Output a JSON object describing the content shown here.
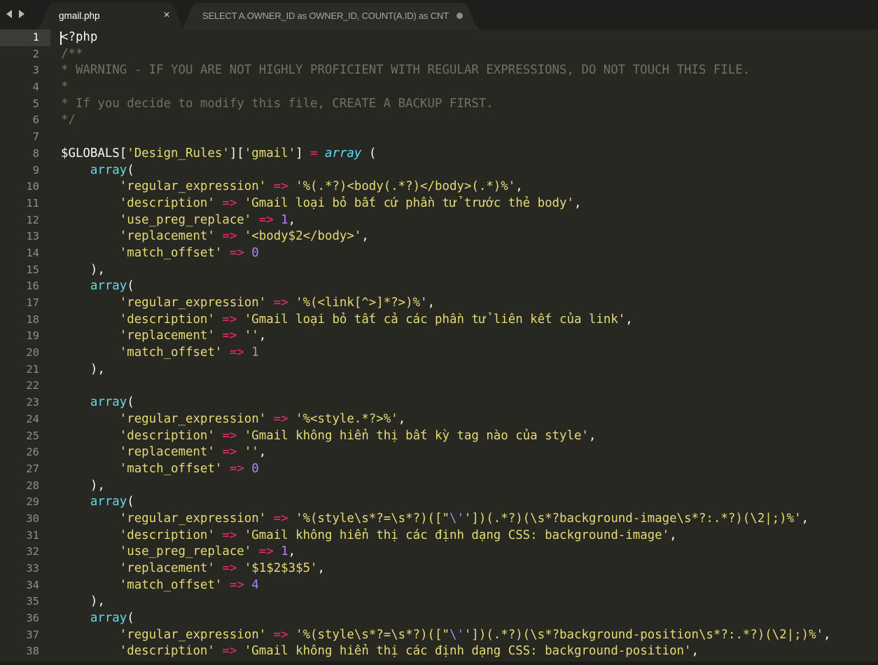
{
  "tabs": [
    {
      "label": "gmail.php",
      "active": true,
      "close_glyph": "×"
    },
    {
      "label": "SELECT A.OWNER_ID as OWNER_ID, COUNT(A.ID) as CNT",
      "active": false,
      "dirty": true
    }
  ],
  "colors": {
    "background": "#272822",
    "tabbar": "#1e1f1c",
    "comment": "#75715e",
    "string": "#e6db74",
    "keyword": "#f92672",
    "function": "#66d9ef",
    "number": "#ae81ff",
    "text": "#f8f8f2"
  },
  "current_line": 1,
  "lines": [
    {
      "n": "1",
      "tokens": [
        {
          "t": "<?php",
          "c": "plain"
        }
      ]
    },
    {
      "n": "2",
      "tokens": [
        {
          "t": "/**",
          "c": "comment"
        }
      ]
    },
    {
      "n": "3",
      "tokens": [
        {
          "t": "* WARNING - IF YOU ARE NOT HIGHLY PROFICIENT WITH REGULAR EXPRESSIONS, DO NOT TOUCH THIS FILE.",
          "c": "comment"
        }
      ]
    },
    {
      "n": "4",
      "tokens": [
        {
          "t": "*",
          "c": "comment"
        }
      ]
    },
    {
      "n": "5",
      "tokens": [
        {
          "t": "* If you decide to modify this file, CREATE A BACKUP FIRST.",
          "c": "comment"
        }
      ]
    },
    {
      "n": "6",
      "tokens": [
        {
          "t": "*/",
          "c": "comment"
        }
      ]
    },
    {
      "n": "7",
      "tokens": []
    },
    {
      "n": "8",
      "tokens": [
        {
          "t": "$GLOBALS[",
          "c": "plain"
        },
        {
          "t": "'Design_Rules'",
          "c": "string"
        },
        {
          "t": "][",
          "c": "plain"
        },
        {
          "t": "'gmail'",
          "c": "string"
        },
        {
          "t": "] ",
          "c": "plain"
        },
        {
          "t": "=",
          "c": "keyword"
        },
        {
          "t": " ",
          "c": "plain"
        },
        {
          "t": "array",
          "c": "storage"
        },
        {
          "t": " (",
          "c": "plain"
        }
      ]
    },
    {
      "n": "9",
      "tokens": [
        {
          "t": "    ",
          "c": "plain"
        },
        {
          "t": "array",
          "c": "func"
        },
        {
          "t": "(",
          "c": "plain"
        }
      ]
    },
    {
      "n": "10",
      "tokens": [
        {
          "t": "        ",
          "c": "plain"
        },
        {
          "t": "'regular_expression'",
          "c": "string"
        },
        {
          "t": " ",
          "c": "plain"
        },
        {
          "t": "=>",
          "c": "keyword"
        },
        {
          "t": " ",
          "c": "plain"
        },
        {
          "t": "'%(.*?)<body(.*?)</body>(.*)%'",
          "c": "string"
        },
        {
          "t": ",",
          "c": "plain"
        }
      ]
    },
    {
      "n": "11",
      "tokens": [
        {
          "t": "        ",
          "c": "plain"
        },
        {
          "t": "'description'",
          "c": "string"
        },
        {
          "t": " ",
          "c": "plain"
        },
        {
          "t": "=>",
          "c": "keyword"
        },
        {
          "t": " ",
          "c": "plain"
        },
        {
          "t": "'Gmail loại bỏ bất cứ phần tử trước thẻ body'",
          "c": "string"
        },
        {
          "t": ",",
          "c": "plain"
        }
      ]
    },
    {
      "n": "12",
      "tokens": [
        {
          "t": "        ",
          "c": "plain"
        },
        {
          "t": "'use_preg_replace'",
          "c": "string"
        },
        {
          "t": " ",
          "c": "plain"
        },
        {
          "t": "=>",
          "c": "keyword"
        },
        {
          "t": " ",
          "c": "plain"
        },
        {
          "t": "1",
          "c": "number"
        },
        {
          "t": ",",
          "c": "plain"
        }
      ]
    },
    {
      "n": "13",
      "tokens": [
        {
          "t": "        ",
          "c": "plain"
        },
        {
          "t": "'replacement'",
          "c": "string"
        },
        {
          "t": " ",
          "c": "plain"
        },
        {
          "t": "=>",
          "c": "keyword"
        },
        {
          "t": " ",
          "c": "plain"
        },
        {
          "t": "'<body$2</body>'",
          "c": "string"
        },
        {
          "t": ",",
          "c": "plain"
        }
      ]
    },
    {
      "n": "14",
      "tokens": [
        {
          "t": "        ",
          "c": "plain"
        },
        {
          "t": "'match_offset'",
          "c": "string"
        },
        {
          "t": " ",
          "c": "plain"
        },
        {
          "t": "=>",
          "c": "keyword"
        },
        {
          "t": " ",
          "c": "plain"
        },
        {
          "t": "0",
          "c": "number"
        }
      ]
    },
    {
      "n": "15",
      "tokens": [
        {
          "t": "    ),",
          "c": "plain"
        }
      ]
    },
    {
      "n": "16",
      "tokens": [
        {
          "t": "    ",
          "c": "plain"
        },
        {
          "t": "array",
          "c": "func"
        },
        {
          "t": "(",
          "c": "plain"
        }
      ]
    },
    {
      "n": "17",
      "tokens": [
        {
          "t": "        ",
          "c": "plain"
        },
        {
          "t": "'regular_expression'",
          "c": "string"
        },
        {
          "t": " ",
          "c": "plain"
        },
        {
          "t": "=>",
          "c": "keyword"
        },
        {
          "t": " ",
          "c": "plain"
        },
        {
          "t": "'%(<link[^>]*?>)%'",
          "c": "string"
        },
        {
          "t": ",",
          "c": "plain"
        }
      ]
    },
    {
      "n": "18",
      "tokens": [
        {
          "t": "        ",
          "c": "plain"
        },
        {
          "t": "'description'",
          "c": "string"
        },
        {
          "t": " ",
          "c": "plain"
        },
        {
          "t": "=>",
          "c": "keyword"
        },
        {
          "t": " ",
          "c": "plain"
        },
        {
          "t": "'Gmail loại bỏ tất cả các phần tử liên kết của link'",
          "c": "string"
        },
        {
          "t": ",",
          "c": "plain"
        }
      ]
    },
    {
      "n": "19",
      "tokens": [
        {
          "t": "        ",
          "c": "plain"
        },
        {
          "t": "'replacement'",
          "c": "string"
        },
        {
          "t": " ",
          "c": "plain"
        },
        {
          "t": "=>",
          "c": "keyword"
        },
        {
          "t": " ",
          "c": "plain"
        },
        {
          "t": "''",
          "c": "string"
        },
        {
          "t": ",",
          "c": "plain"
        }
      ]
    },
    {
      "n": "20",
      "tokens": [
        {
          "t": "        ",
          "c": "plain"
        },
        {
          "t": "'match_offset'",
          "c": "string"
        },
        {
          "t": " ",
          "c": "plain"
        },
        {
          "t": "=>",
          "c": "keyword"
        },
        {
          "t": " ",
          "c": "plain"
        },
        {
          "t": "1",
          "c": "number"
        }
      ]
    },
    {
      "n": "21",
      "tokens": [
        {
          "t": "    ),",
          "c": "plain"
        }
      ]
    },
    {
      "n": "22",
      "tokens": []
    },
    {
      "n": "23",
      "tokens": [
        {
          "t": "    ",
          "c": "plain"
        },
        {
          "t": "array",
          "c": "func"
        },
        {
          "t": "(",
          "c": "plain"
        }
      ]
    },
    {
      "n": "24",
      "tokens": [
        {
          "t": "        ",
          "c": "plain"
        },
        {
          "t": "'regular_expression'",
          "c": "string"
        },
        {
          "t": " ",
          "c": "plain"
        },
        {
          "t": "=>",
          "c": "keyword"
        },
        {
          "t": " ",
          "c": "plain"
        },
        {
          "t": "'%<style.*?>%'",
          "c": "string"
        },
        {
          "t": ",",
          "c": "plain"
        }
      ]
    },
    {
      "n": "25",
      "tokens": [
        {
          "t": "        ",
          "c": "plain"
        },
        {
          "t": "'description'",
          "c": "string"
        },
        {
          "t": " ",
          "c": "plain"
        },
        {
          "t": "=>",
          "c": "keyword"
        },
        {
          "t": " ",
          "c": "plain"
        },
        {
          "t": "'Gmail không hiển thị bất kỳ tag nào của style'",
          "c": "string"
        },
        {
          "t": ",",
          "c": "plain"
        }
      ]
    },
    {
      "n": "26",
      "tokens": [
        {
          "t": "        ",
          "c": "plain"
        },
        {
          "t": "'replacement'",
          "c": "string"
        },
        {
          "t": " ",
          "c": "plain"
        },
        {
          "t": "=>",
          "c": "keyword"
        },
        {
          "t": " ",
          "c": "plain"
        },
        {
          "t": "''",
          "c": "string"
        },
        {
          "t": ",",
          "c": "plain"
        }
      ]
    },
    {
      "n": "27",
      "tokens": [
        {
          "t": "        ",
          "c": "plain"
        },
        {
          "t": "'match_offset'",
          "c": "string"
        },
        {
          "t": " ",
          "c": "plain"
        },
        {
          "t": "=>",
          "c": "keyword"
        },
        {
          "t": " ",
          "c": "plain"
        },
        {
          "t": "0",
          "c": "number"
        }
      ]
    },
    {
      "n": "28",
      "tokens": [
        {
          "t": "    ),",
          "c": "plain"
        }
      ]
    },
    {
      "n": "29",
      "tokens": [
        {
          "t": "    ",
          "c": "plain"
        },
        {
          "t": "array",
          "c": "func"
        },
        {
          "t": "(",
          "c": "plain"
        }
      ]
    },
    {
      "n": "30",
      "tokens": [
        {
          "t": "        ",
          "c": "plain"
        },
        {
          "t": "'regular_expression'",
          "c": "string"
        },
        {
          "t": " ",
          "c": "plain"
        },
        {
          "t": "=>",
          "c": "keyword"
        },
        {
          "t": " ",
          "c": "plain"
        },
        {
          "t": "'%(style\\s*?=\\s*?)([\"",
          "c": "string"
        },
        {
          "t": "\\'",
          "c": "escape"
        },
        {
          "t": "'])(.*?)(\\s*?background-image\\s*?:.*?)(\\2|;)%'",
          "c": "string"
        },
        {
          "t": ",",
          "c": "plain"
        }
      ]
    },
    {
      "n": "31",
      "tokens": [
        {
          "t": "        ",
          "c": "plain"
        },
        {
          "t": "'description'",
          "c": "string"
        },
        {
          "t": " ",
          "c": "plain"
        },
        {
          "t": "=>",
          "c": "keyword"
        },
        {
          "t": " ",
          "c": "plain"
        },
        {
          "t": "'Gmail không hiển thị các định dạng CSS: background-image'",
          "c": "string"
        },
        {
          "t": ",",
          "c": "plain"
        }
      ]
    },
    {
      "n": "32",
      "tokens": [
        {
          "t": "        ",
          "c": "plain"
        },
        {
          "t": "'use_preg_replace'",
          "c": "string"
        },
        {
          "t": " ",
          "c": "plain"
        },
        {
          "t": "=>",
          "c": "keyword"
        },
        {
          "t": " ",
          "c": "plain"
        },
        {
          "t": "1",
          "c": "number"
        },
        {
          "t": ",",
          "c": "plain"
        }
      ]
    },
    {
      "n": "33",
      "tokens": [
        {
          "t": "        ",
          "c": "plain"
        },
        {
          "t": "'replacement'",
          "c": "string"
        },
        {
          "t": " ",
          "c": "plain"
        },
        {
          "t": "=>",
          "c": "keyword"
        },
        {
          "t": " ",
          "c": "plain"
        },
        {
          "t": "'$1$2$3$5'",
          "c": "string"
        },
        {
          "t": ",",
          "c": "plain"
        }
      ]
    },
    {
      "n": "34",
      "tokens": [
        {
          "t": "        ",
          "c": "plain"
        },
        {
          "t": "'match_offset'",
          "c": "string"
        },
        {
          "t": " ",
          "c": "plain"
        },
        {
          "t": "=>",
          "c": "keyword"
        },
        {
          "t": " ",
          "c": "plain"
        },
        {
          "t": "4",
          "c": "number"
        }
      ]
    },
    {
      "n": "35",
      "tokens": [
        {
          "t": "    ),",
          "c": "plain"
        }
      ]
    },
    {
      "n": "36",
      "tokens": [
        {
          "t": "    ",
          "c": "plain"
        },
        {
          "t": "array",
          "c": "func"
        },
        {
          "t": "(",
          "c": "plain"
        }
      ]
    },
    {
      "n": "37",
      "tokens": [
        {
          "t": "        ",
          "c": "plain"
        },
        {
          "t": "'regular_expression'",
          "c": "string"
        },
        {
          "t": " ",
          "c": "plain"
        },
        {
          "t": "=>",
          "c": "keyword"
        },
        {
          "t": " ",
          "c": "plain"
        },
        {
          "t": "'%(style\\s*?=\\s*?)([\"",
          "c": "string"
        },
        {
          "t": "\\'",
          "c": "escape"
        },
        {
          "t": "'])(.*?)(\\s*?background-position\\s*?:.*?)(\\2|;)%'",
          "c": "string"
        },
        {
          "t": ",",
          "c": "plain"
        }
      ]
    },
    {
      "n": "38",
      "tokens": [
        {
          "t": "        ",
          "c": "plain"
        },
        {
          "t": "'description'",
          "c": "string"
        },
        {
          "t": " ",
          "c": "plain"
        },
        {
          "t": "=>",
          "c": "keyword"
        },
        {
          "t": " ",
          "c": "plain"
        },
        {
          "t": "'Gmail không hiển thị các định dạng CSS: background-position'",
          "c": "string"
        },
        {
          "t": ",",
          "c": "plain"
        }
      ]
    }
  ]
}
